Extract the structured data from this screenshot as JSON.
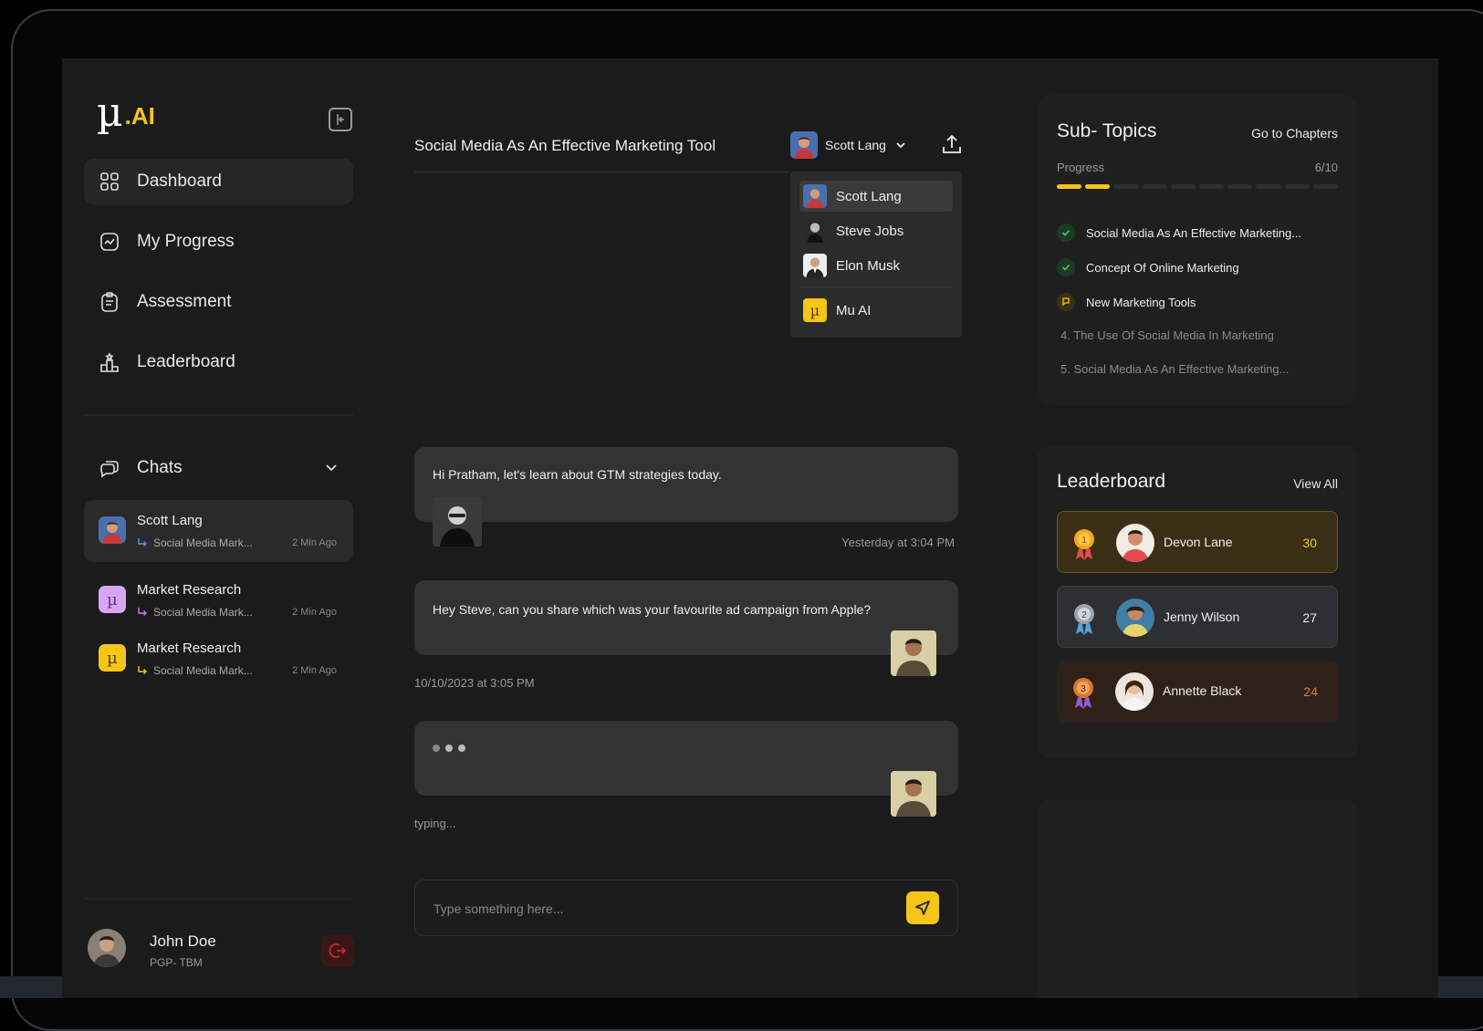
{
  "brand": {
    "mu": "µ",
    "ai": ".AI",
    "accent": "#f5c518"
  },
  "nav": [
    {
      "label": "Dashboard",
      "icon": "grid-icon",
      "active": true
    },
    {
      "label": "My Progress",
      "icon": "chart-icon"
    },
    {
      "label": "Assessment",
      "icon": "clipboard-icon"
    },
    {
      "label": "Leaderboard",
      "icon": "podium-icon"
    }
  ],
  "chats": {
    "label": "Chats",
    "items": [
      {
        "name": "Scott Lang",
        "sub": "Social Media Mark...",
        "time": "2 Min Ago",
        "avatar": "Scott Lang"
      },
      {
        "name": "Market Research",
        "sub": "Social Media Mark...",
        "time": "2 Min Ago",
        "avatar": "µ",
        "color": "#d9a6f5"
      },
      {
        "name": "Market Research",
        "sub": "Social Media Mark...",
        "time": "2 Min Ago",
        "avatar": "µ",
        "color": "#f5c518"
      }
    ]
  },
  "user": {
    "name": "John Doe",
    "role": "PGP- TBM"
  },
  "main": {
    "title": "Social Media As An Effective Marketing Tool",
    "persona": "Scott Lang",
    "dropdown": [
      "Scott Lang",
      "Steve Jobs",
      "Elon Musk",
      "Mu AI"
    ],
    "messages": [
      {
        "text": "Hi Pratham, let's learn about GTM strategies today.",
        "time": "Yesterday at 3:04 PM"
      },
      {
        "text": "Hey Steve, can you share which was your favourite ad campaign from Apple?",
        "time": "10/10/2023 at 3:05 PM"
      },
      {
        "text": "",
        "time": "typing..."
      }
    ],
    "input_placeholder": "Type something here..."
  },
  "subtopics": {
    "title": "Sub- Topics",
    "link": "Go to Chapters",
    "progress_label": "Progress",
    "progress_value": "6/10",
    "progress": 0.2,
    "items": [
      {
        "text": "Social Media As An Effective Marketing...",
        "status": "done"
      },
      {
        "text": "Concept Of Online Marketing",
        "status": "done"
      },
      {
        "text": "New Marketing Tools",
        "status": "current"
      },
      {
        "text": "4. The Use Of Social Media In Marketing",
        "status": "todo"
      },
      {
        "text": "5. Social Media As An Effective Marketing...",
        "status": "todo"
      }
    ]
  },
  "leaderboard": {
    "title": "Leaderboard",
    "link": "View All",
    "rows": [
      {
        "rank": "1",
        "name": "Devon Lane",
        "score": "30",
        "bg": "#3a2f14",
        "border": "#6b5420",
        "scoreColor": "#f5c518"
      },
      {
        "rank": "2",
        "name": "Jenny Wilson",
        "score": "27",
        "bg": "#2b2d30",
        "border": "#3a3d42",
        "scoreColor": "#e8e8e8"
      },
      {
        "rank": "3",
        "name": "Annette Black",
        "score": "24",
        "bg": "#2b1f19",
        "border": "#2b1f19",
        "scoreColor": "#e07a3a"
      }
    ]
  }
}
